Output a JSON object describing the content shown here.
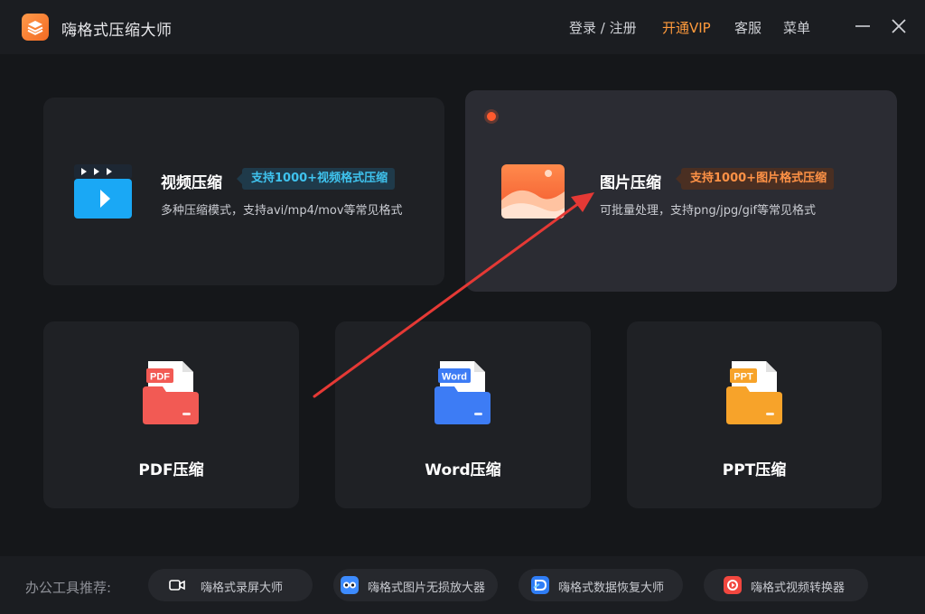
{
  "app": {
    "title": "嗨格式压缩大师"
  },
  "topnav": {
    "login": "登录 / 注册",
    "vip": "开通VIP",
    "service": "客服",
    "menu": "菜单"
  },
  "cards": {
    "video": {
      "title": "视频压缩",
      "badge": "支持1000+视频格式压缩",
      "desc": "多种压缩模式，支持avi/mp4/mov等常见格式"
    },
    "image": {
      "title": "图片压缩",
      "badge": "支持1000+图片格式压缩",
      "desc": "可批量处理，支持png/jpg/gif等常见格式"
    },
    "pdf": {
      "title": "PDF压缩",
      "icon_text": "PDF"
    },
    "word": {
      "title": "Word压缩",
      "icon_text": "Word"
    },
    "ppt": {
      "title": "PPT压缩",
      "icon_text": "PPT"
    }
  },
  "footer": {
    "label": "办公工具推荐:",
    "tools": [
      {
        "label": "嗨格式录屏大师",
        "icon": "camera-icon"
      },
      {
        "label": "嗨格式图片无损放大器",
        "icon": "owl-icon"
      },
      {
        "label": "嗨格式数据恢复大师",
        "icon": "recovery-icon"
      },
      {
        "label": "嗨格式视频转换器",
        "icon": "convert-icon"
      }
    ]
  },
  "colors": {
    "accent": "#ff9a3c",
    "annotation_arrow": "#e53935",
    "pdf": "#f25a54",
    "word": "#3d7cf5",
    "ppt": "#f7a32a"
  }
}
